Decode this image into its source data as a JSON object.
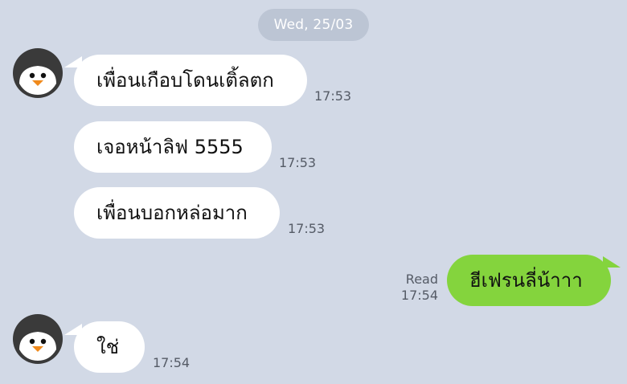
{
  "date_chip": "Wed, 25/03",
  "messages": [
    {
      "side": "in",
      "text": "เพื่อนเกือบโดนเติ้ลตก",
      "time": "17:53"
    },
    {
      "side": "in",
      "text": "เจอหน้าลิฟ 5555",
      "time": "17:53"
    },
    {
      "side": "in",
      "text": "เพื่อนบอกหล่อมาก",
      "time": "17:53"
    },
    {
      "side": "out",
      "text": "ฮีเฟรนลี่น้าาา",
      "status": "Read",
      "time": "17:54"
    },
    {
      "side": "in",
      "text": "ใช่",
      "time": "17:54"
    }
  ],
  "colors": {
    "background": "#d2d9e6",
    "incoming_bubble": "#ffffff",
    "outgoing_bubble": "#84d43d",
    "date_chip": "#bcc5d4"
  },
  "icons": {
    "avatar": "penguin-avatar-icon"
  }
}
